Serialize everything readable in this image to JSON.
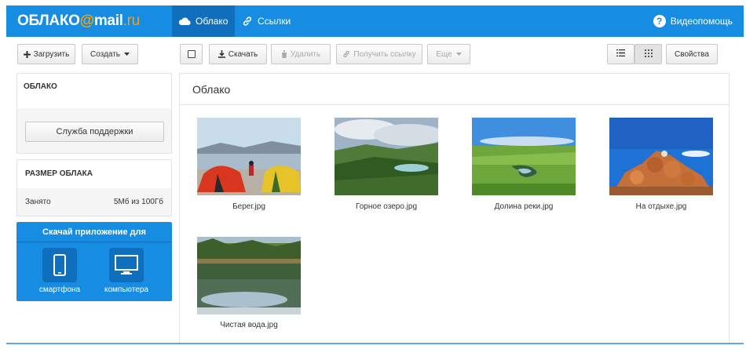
{
  "header": {
    "logo_text": "ОБЛАКО",
    "logo_at": "@",
    "logo_mail": "mail",
    "logo_dot_ru": ".ru",
    "tabs": [
      {
        "label": "Облако",
        "icon": "cloud-icon",
        "active": true
      },
      {
        "label": "Ссылки",
        "icon": "link-icon",
        "active": false
      }
    ],
    "help_label": "Видеопомощь",
    "brand_color": "#168de2",
    "accent_color": "#ff9e00"
  },
  "toolbar": {
    "upload_label": "Загрузить",
    "create_label": "Создать",
    "download_label": "Скачать",
    "delete_label": "Удалить",
    "get_link_label": "Получить ссылку",
    "more_label": "Еще",
    "properties_label": "Свойства"
  },
  "sidebar": {
    "cloud_title": "ОБЛАКО",
    "support_label": "Служба поддержки",
    "size_title": "РАЗМЕР ОБЛАКА",
    "used_label": "Занято",
    "used_value": "5Мб из 100Гб",
    "app_promo": {
      "title": "Скачай приложение для",
      "items": [
        {
          "label": "смартфона",
          "icon": "smartphone-icon"
        },
        {
          "label": "компьютера",
          "icon": "monitor-icon"
        }
      ]
    }
  },
  "main": {
    "title": "Облако",
    "files": [
      {
        "name": "Берег.jpg"
      },
      {
        "name": "Горное озеро.jpg"
      },
      {
        "name": "Долина реки.jpg"
      },
      {
        "name": "На отдыхе.jpg"
      },
      {
        "name": "Чистая вода.jpg"
      }
    ]
  }
}
